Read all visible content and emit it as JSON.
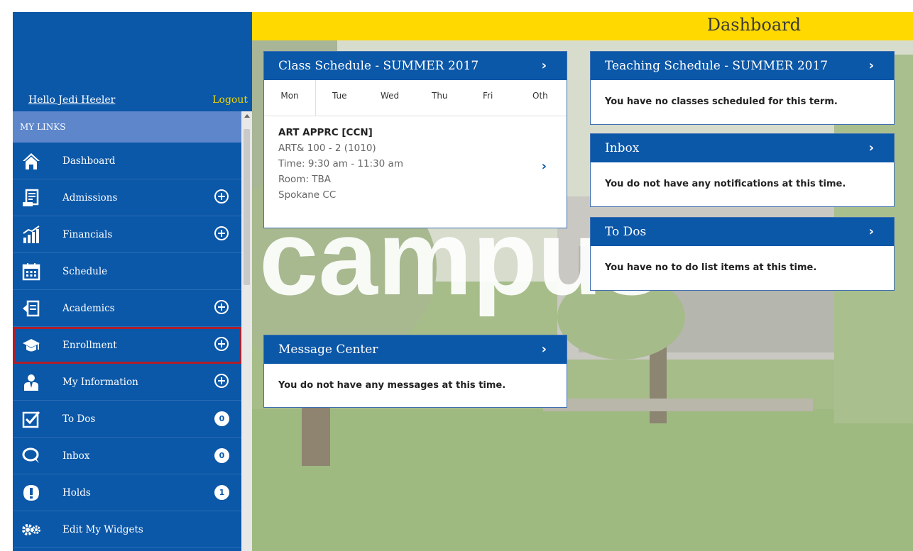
{
  "sidebar": {
    "greeting": "Hello Jedi Heeler",
    "logout": "Logout",
    "section_title": "MY LINKS",
    "items": [
      {
        "label": "Dashboard",
        "icon": "home-icon"
      },
      {
        "label": "Admissions",
        "icon": "admissions-icon"
      },
      {
        "label": "Financials",
        "icon": "financials-icon"
      },
      {
        "label": "Schedule",
        "icon": "calendar-icon"
      },
      {
        "label": "Academics",
        "icon": "academics-icon"
      },
      {
        "label": "Enrollment",
        "icon": "graduation-cap-icon"
      },
      {
        "label": "My Information",
        "icon": "person-icon"
      },
      {
        "label": "To Dos",
        "icon": "checkbox-icon",
        "badge": "0"
      },
      {
        "label": "Inbox",
        "icon": "chat-icon",
        "badge": "0"
      },
      {
        "label": "Holds",
        "icon": "alert-icon",
        "badge": "1"
      },
      {
        "label": "Edit My Widgets",
        "icon": "gears-icon"
      }
    ]
  },
  "header": {
    "title": "Dashboard"
  },
  "background_text": "campus",
  "class_schedule": {
    "title": "Class Schedule - SUMMER 2017",
    "tabs": [
      "Mon",
      "Tue",
      "Wed",
      "Thu",
      "Fri",
      "Oth"
    ],
    "active_tab": "Mon",
    "course": {
      "name": "ART APPRC [CCN]",
      "section": "ART& 100 - 2 (1010)",
      "time": "Time: 9:30 am - 11:30 am",
      "room": "Room: TBA",
      "campus": "Spokane CC"
    }
  },
  "teaching_schedule": {
    "title": "Teaching Schedule - SUMMER 2017",
    "message": "You have no classes scheduled for this term."
  },
  "inbox": {
    "title": "Inbox",
    "message": "You do not have any notifications at this time."
  },
  "todos": {
    "title": "To Dos",
    "message": "You have no to do list items at this time."
  },
  "message_center": {
    "title": "Message Center",
    "message": "You do not have any messages at this time."
  },
  "colors": {
    "brand_blue": "#0b57a8",
    "header_yellow": "#ffd900",
    "logout_yellow": "#f1d600",
    "selection_red": "#b01e2a"
  }
}
